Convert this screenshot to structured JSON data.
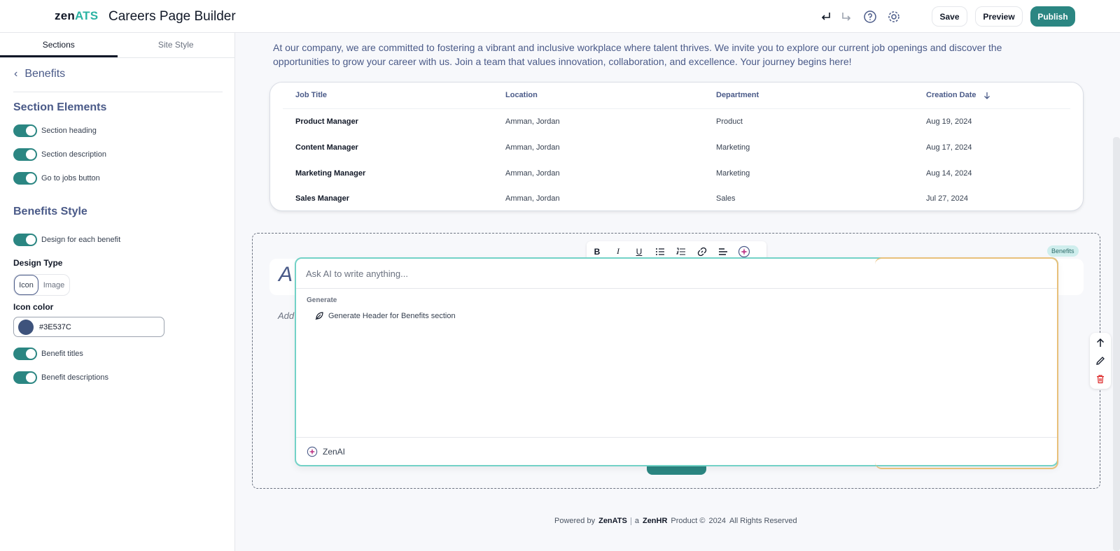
{
  "header": {
    "logo_zen": "zen",
    "logo_ats": "ATS",
    "title": "Careers Page Builder",
    "icons": [
      "undo-icon",
      "redo-icon",
      "help-icon",
      "settings-icon"
    ],
    "save_label": "Save",
    "preview_label": "Preview",
    "publish_label": "Publish"
  },
  "sidebar": {
    "tabs": [
      {
        "label": "Sections",
        "active": true
      },
      {
        "label": "Site Style",
        "active": false
      }
    ],
    "back_label": "Benefits",
    "section_elements_heading": "Section Elements",
    "section_elements": [
      {
        "label": "Section heading",
        "on": true
      },
      {
        "label": "Section description",
        "on": true
      },
      {
        "label": "Go to jobs button",
        "on": true
      }
    ],
    "benefits_style_heading": "Benefits Style",
    "design_each_label": "Design for each benefit",
    "design_type_label": "Design Type",
    "design_type_options": [
      "Icon",
      "Image"
    ],
    "design_type_selected": "Icon",
    "icon_color_label": "Icon color",
    "icon_color_value": "#3E537C",
    "benefit_titles_label": "Benefit titles",
    "benefit_descriptions_label": "Benefit descriptions"
  },
  "main": {
    "intro": "At our company, we are committed to fostering a vibrant and inclusive workplace where talent thrives. We invite you to explore our current job openings and discover the opportunities to grow your career with us. Join a team that values innovation, collaboration, and excellence. Your journey begins here!",
    "jobs_table": {
      "columns": [
        "Job Title",
        "Location",
        "Department",
        "Creation Date"
      ],
      "rows": [
        [
          "Product Manager",
          "Amman, Jordan",
          "Product",
          "Aug 19, 2024"
        ],
        [
          "Content Manager",
          "Amman, Jordan",
          "Marketing",
          "Aug 17, 2024"
        ],
        [
          "Marketing Manager",
          "Amman, Jordan",
          "Marketing",
          "Aug 14, 2024"
        ],
        [
          "Sales Manager",
          "Amman, Jordan",
          "Sales",
          "Jul 27, 2024"
        ]
      ]
    },
    "benefits_tag": "Benefits",
    "behind_heading": "A",
    "behind_desc": "Add",
    "toolbar_icons": [
      "bold-icon",
      "italic-icon",
      "underline-icon",
      "bullet-list-icon",
      "numbered-list-icon",
      "link-icon",
      "align-icon",
      "ai-sparkle-icon"
    ],
    "toolbar_glyphs": [
      "B",
      "I",
      "U"
    ]
  },
  "ai_panel": {
    "placeholder": "Ask AI to write anything...",
    "section_label": "Generate",
    "suggestion": "Generate Header for Benefits section",
    "footer_label": "ZenAI"
  },
  "footer": {
    "powered_by": "Powered by",
    "brand1": "ZenATS",
    "a": "a",
    "brand2": "ZenHR",
    "product": "Product ©",
    "year": "2024",
    "rights": "All Rights Reserved"
  },
  "colors": {
    "accent": "#2b8682",
    "heading": "#4a5a88",
    "icon_color": "#3E537C"
  }
}
